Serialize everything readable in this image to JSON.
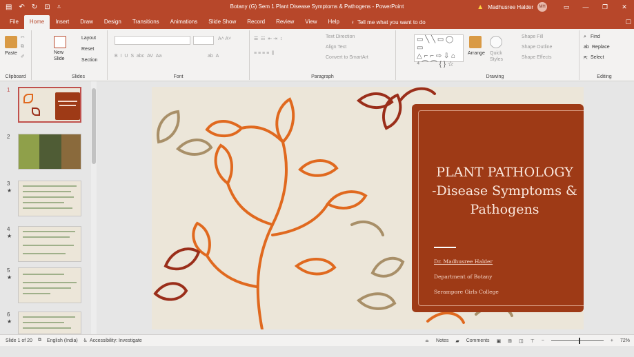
{
  "titlebar": {
    "title": "Botany (G) Sem 1 Plant Disease Symptoms & Pathogens  -  PowerPoint",
    "user": "Madhusree Halder",
    "initials": "MH",
    "warning_icon": "warning-icon"
  },
  "tabs": [
    "File",
    "Home",
    "Insert",
    "Draw",
    "Design",
    "Transitions",
    "Animations",
    "Slide Show",
    "Record",
    "Review",
    "View",
    "Help"
  ],
  "tell_me": "Tell me what you want to do",
  "ribbon": {
    "clipboard": {
      "label": "Clipboard",
      "paste": "Paste"
    },
    "slides": {
      "label": "Slides",
      "new_slide": "New",
      "new_slide2": "Slide",
      "layout": "Layout",
      "reset": "Reset",
      "section": "Section"
    },
    "font": {
      "label": "Font"
    },
    "paragraph": {
      "label": "Paragraph",
      "text_direction": "Text Direction",
      "align_text": "Align Text",
      "smartart": "Convert to SmartArt"
    },
    "drawing": {
      "label": "Drawing",
      "arrange": "Arrange",
      "quick_styles": "Quick",
      "quick_styles2": "Styles",
      "shape_fill": "Shape Fill",
      "shape_outline": "Shape Outline",
      "shape_effects": "Shape Effects"
    },
    "editing": {
      "label": "Editing",
      "find": "Find",
      "replace": "Replace",
      "select": "Select"
    }
  },
  "thumbnails": [
    {
      "num": "1",
      "star": ""
    },
    {
      "num": "2",
      "star": ""
    },
    {
      "num": "3",
      "star": "★"
    },
    {
      "num": "4",
      "star": "★"
    },
    {
      "num": "5",
      "star": "★"
    },
    {
      "num": "6",
      "star": "★"
    }
  ],
  "slide": {
    "title_line1": "PLANT PATHOLOGY",
    "title_line2": "-Disease Symptoms &",
    "title_line3": "Pathogens",
    "author": "Dr. Madhusree Halder",
    "department": "Department of Botany",
    "college": "Serampore Girls  College"
  },
  "status": {
    "slide_count": "Slide 1 of 20",
    "language": "English (India)",
    "accessibility": "Accessibility: Investigate",
    "notes": "Notes",
    "comments": "Comments",
    "zoom": "72%"
  },
  "colors": {
    "brand": "#b7472a",
    "title_card": "#9e3a16",
    "slide_bg": "#ece6d9",
    "leaf_orange": "#e0691f",
    "leaf_red": "#9a2e1a",
    "leaf_tan": "#a88f68"
  }
}
